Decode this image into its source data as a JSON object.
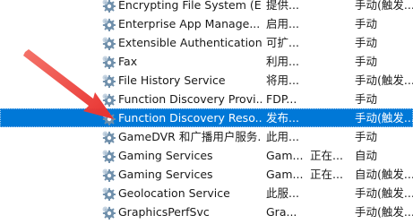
{
  "services": [
    {
      "name": "Encrypting File System (E...",
      "description": "提供...",
      "status": "",
      "startup": "手动(触发..."
    },
    {
      "name": "Enterprise App Manage...",
      "description": "启用...",
      "status": "",
      "startup": "手动"
    },
    {
      "name": "Extensible Authentication...",
      "description": "可扩...",
      "status": "",
      "startup": "手动"
    },
    {
      "name": "Fax",
      "description": "利用...",
      "status": "",
      "startup": "手动"
    },
    {
      "name": "File History Service",
      "description": "将用...",
      "status": "",
      "startup": "手动(触发..."
    },
    {
      "name": "Function Discovery Provi...",
      "description": "FDP...",
      "status": "",
      "startup": "手动"
    },
    {
      "name": "Function Discovery Reso...",
      "description": "发布...",
      "status": "",
      "startup": "手动(触发..."
    },
    {
      "name": "GameDVR 和广播用户服务...",
      "description": "此用...",
      "status": "",
      "startup": "手动"
    },
    {
      "name": "Gaming Services",
      "description": "Gam...",
      "status": "正在...",
      "startup": "自动"
    },
    {
      "name": "Gaming Services",
      "description": "Gam...",
      "status": "正在...",
      "startup": "自动(触发..."
    },
    {
      "name": "Geolocation Service",
      "description": "此服...",
      "status": "",
      "startup": "手动(触发..."
    },
    {
      "name": "GraphicsPerfSvc",
      "description": "Gra...",
      "status": "",
      "startup": "手动(触发..."
    }
  ],
  "selected_index": 6,
  "icon": "gear-icon",
  "colors": {
    "selection": "#0078d7",
    "annotation_arrow": "#e8312f",
    "gear": "#6f8fab"
  }
}
